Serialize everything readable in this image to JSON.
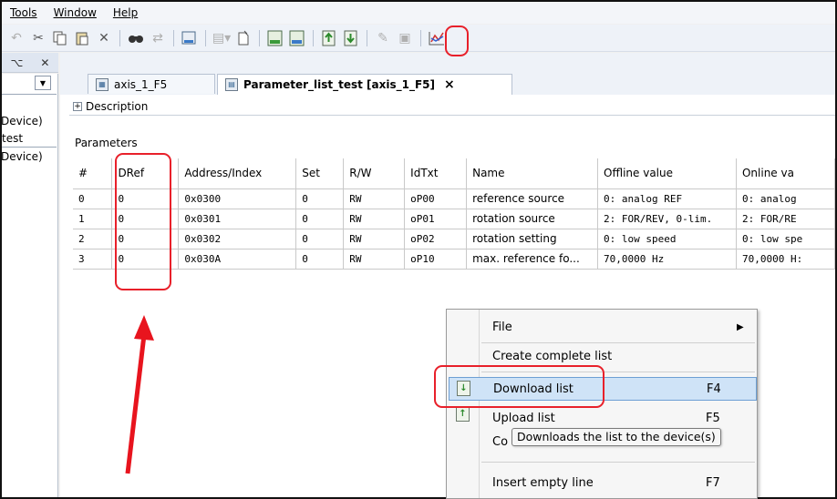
{
  "menu": {
    "items": [
      {
        "label": "Tools"
      },
      {
        "label": "Window"
      },
      {
        "label": "Help"
      }
    ]
  },
  "toolbar": {
    "icons": [
      "undo-icon",
      "cut-icon",
      "copy-icon",
      "paste-icon",
      "delete-icon",
      "find-icon",
      "find-replace-icon",
      "device-icon",
      "add-device-icon",
      "insert-icon",
      "device-a-icon",
      "device-b-icon",
      "upload-list-icon",
      "download-list-icon",
      "edit-icon",
      "tool-icon",
      "chart-icon"
    ]
  },
  "left_panel": {
    "pin_glyph": "⌥",
    "close_glyph": "✕",
    "rows": [
      "Device)",
      "test",
      "Device)"
    ]
  },
  "tabs": [
    {
      "label": "axis_1_F5",
      "active": false
    },
    {
      "label": "Parameter_list_test [axis_1_F5]",
      "active": true,
      "close": "×"
    }
  ],
  "description": {
    "expander": "+",
    "label": "Description"
  },
  "parameters_label": "Parameters",
  "table": {
    "columns": [
      "#",
      "DRef",
      "Address/Index",
      "Set",
      "R/W",
      "IdTxt",
      "Name",
      "Offline value",
      "Online va"
    ],
    "rows": [
      [
        "0",
        "0",
        "0x0300",
        "0",
        "RW",
        "oP00",
        "reference source",
        "0: analog REF",
        "0: analog"
      ],
      [
        "1",
        "0",
        "0x0301",
        "0",
        "RW",
        "oP01",
        "rotation source",
        "2: FOR/REV, 0-lim.",
        "2: FOR/RE"
      ],
      [
        "2",
        "0",
        "0x0302",
        "0",
        "RW",
        "oP02",
        "rotation setting",
        "0: low speed",
        "0: low spe"
      ],
      [
        "3",
        "0",
        "0x030A",
        "0",
        "RW",
        "oP10",
        "max. reference fo...",
        "70,0000 Hz",
        "70,0000 H:"
      ]
    ]
  },
  "context_menu": {
    "file": {
      "label": "File",
      "arrow": "▶"
    },
    "create_complete": {
      "label": "Create complete list"
    },
    "download": {
      "label": "Download list",
      "key": "F4"
    },
    "upload": {
      "label": "Upload list",
      "key": "F5"
    },
    "compare": {
      "label": "Co"
    },
    "insert_empty": {
      "label": "Insert empty line",
      "key": "F7"
    }
  },
  "tooltip": "Downloads the list to the device(s)",
  "colors": {
    "highlight": "#e8202a",
    "selection": "#cfe3f7"
  }
}
